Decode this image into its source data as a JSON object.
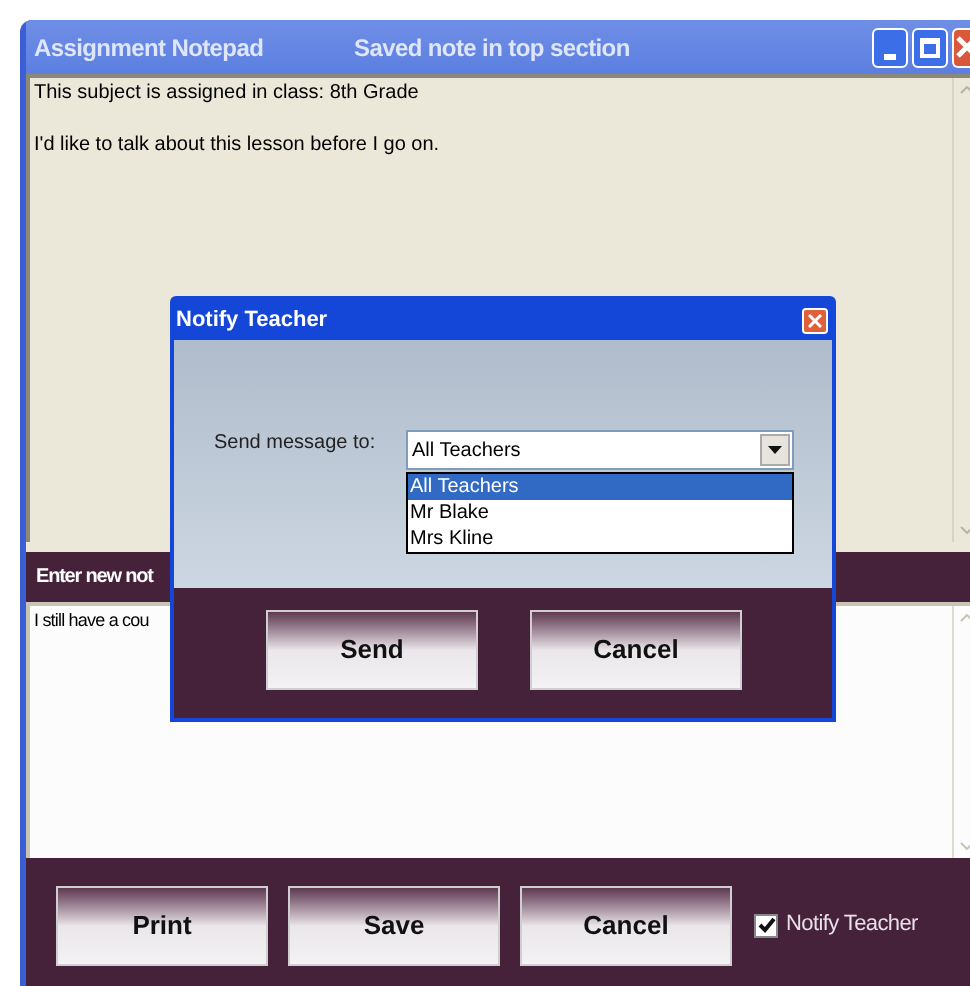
{
  "window": {
    "title": "Assignment Notepad",
    "status": "Saved note in top section"
  },
  "saved_note": {
    "lines": [
      "This subject is assigned in class: 8th Grade",
      "I'd like to talk about this lesson before I go on."
    ]
  },
  "new_note": {
    "header": "Enter new not",
    "value": "I still have a cou"
  },
  "buttons": [
    "Print",
    "Save",
    "Cancel"
  ],
  "notify_teacher": {
    "label": "Notify Teacher",
    "checked": true
  },
  "dialog": {
    "title": "Notify Teacher",
    "label": "Send message to:",
    "value": "All Teachers",
    "options": [
      {
        "label": "All Teachers",
        "selected": true
      },
      {
        "label": "Mr Blake",
        "selected": false
      },
      {
        "label": "Mrs Kline",
        "selected": false
      }
    ],
    "buttons": [
      "Send",
      "Cancel"
    ]
  }
}
